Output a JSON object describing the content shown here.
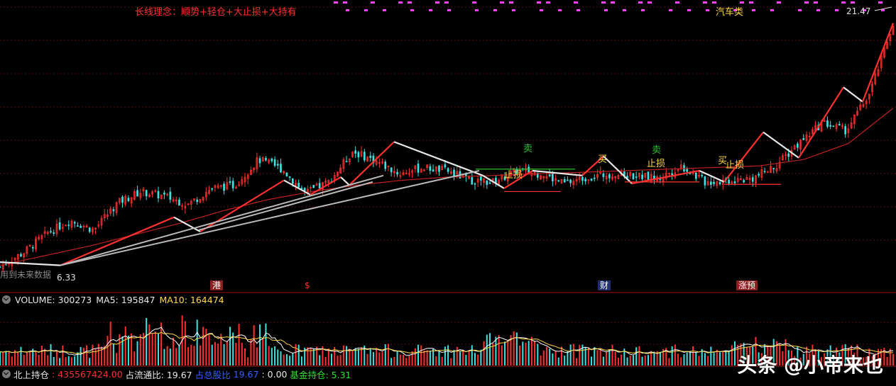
{
  "header": {
    "strategy_text": "长线理念：顺势+轻仓+大止损+大持有",
    "sector": "汽车类",
    "last_price": "21.47"
  },
  "price_panel": {
    "low_label": "6.33",
    "future_label": "用到未来数据",
    "event_badges": [
      {
        "label": "港",
        "color": "#b03030"
      },
      {
        "label": "$",
        "color": "#ff3030"
      },
      {
        "label": "财",
        "color": "#3050b0"
      },
      {
        "label": "涨预",
        "color": "#b03030"
      }
    ],
    "signals": [
      {
        "label": "止损",
        "color": "#ffd84a"
      },
      {
        "label": "卖",
        "color": "#30c030"
      },
      {
        "label": "买",
        "color": "#ffd84a"
      },
      {
        "label": "卖",
        "color": "#30c030"
      },
      {
        "label": "止损",
        "color": "#ffd84a"
      },
      {
        "label": "买",
        "color": "#ffd84a"
      },
      {
        "label": "止损",
        "color": "#ffd84a"
      }
    ]
  },
  "volume_panel": {
    "volume_label": "VOLUME: 300273",
    "ma5_label": "MA5: 195847",
    "ma10_label": "MA10: 164474"
  },
  "holdings_panel": {
    "north_label": "北上持仓",
    "north_value": ": 435567424.00",
    "float_label": "占流通比: 19.67",
    "total_label": "占总股比",
    "total_value": "19.67",
    "extra_value": ": 0.00",
    "fund_label": "基金持仓: 5.31"
  },
  "watermark": "头条 @小帝来也",
  "colors": {
    "up": "#ff3030",
    "down": "#40e0e0",
    "ma": "#c02020",
    "ma5": "#ffffff",
    "ma10": "#ffd84a",
    "accent": "#ff40ff"
  },
  "chart_data": {
    "type": "line",
    "title": "",
    "last_price": 21.47,
    "low_price": 6.33,
    "series": [
      {
        "name": "",
        "values": [
          6.3,
          7.2,
          8.4,
          9.2,
          8.6,
          10.3,
          11.0,
          10.7,
          10.2,
          11.2,
          11.4,
          13.0,
          12.4,
          10.9,
          11.6,
          13.5,
          12.9,
          12.1,
          12.5,
          12.3,
          11.7,
          11.6,
          12.3,
          12.1,
          11.5,
          11.9,
          12.1,
          12.0,
          11.8,
          12.6,
          11.6,
          11.7,
          11.8,
          12.6,
          14.0,
          15.3,
          14.8,
          17.1,
          21.5
        ]
      },
      {
        "name": "",
        "values": [
          6.4,
          7.0,
          7.6,
          8.3,
          9.0,
          9.8,
          10.5,
          11.0,
          11.4,
          11.7,
          11.9,
          12.0,
          12.1,
          12.2,
          12.3,
          12.4,
          12.5,
          12.6,
          13.0,
          14.0,
          16.2
        ]
      }
    ],
    "volume": {
      "last": 300273,
      "ma5": 195847,
      "ma10": 164474
    }
  }
}
